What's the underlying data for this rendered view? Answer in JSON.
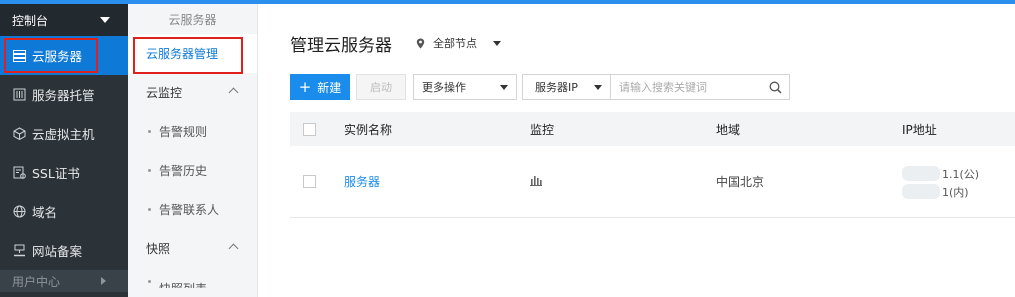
{
  "sidebar": {
    "header": "控制台",
    "items": [
      {
        "label": "云服务器",
        "icon": "server-list-icon",
        "active": true
      },
      {
        "label": "服务器托管",
        "icon": "server-rack-icon"
      },
      {
        "label": "云虚拟主机",
        "icon": "cube-icon"
      },
      {
        "label": "SSL证书",
        "icon": "certificate-icon"
      },
      {
        "label": "域名",
        "icon": "globe-icon"
      },
      {
        "label": "网站备案",
        "icon": "filing-icon"
      }
    ],
    "footer": "用户中心"
  },
  "subnav": {
    "title": "云服务器",
    "items": [
      {
        "label": "云服务器管理",
        "active": true
      },
      {
        "label": "云监控",
        "group": true
      },
      {
        "label": "告警规则"
      },
      {
        "label": "告警历史"
      },
      {
        "label": "告警联系人"
      },
      {
        "label": "快照",
        "group": true
      },
      {
        "label": "快照列表"
      }
    ]
  },
  "main": {
    "title": "管理云服务器",
    "region": "全部节点",
    "toolbar": {
      "new_label": "新建",
      "start_label": "启动",
      "more_label": "更多操作",
      "search_field": "服务器IP",
      "search_placeholder": "请输入搜索关键词"
    },
    "table": {
      "columns": [
        "实例名称",
        "监控",
        "地域",
        "IP地址"
      ],
      "rows": [
        {
          "name": "服务器",
          "region": "中国北京",
          "ip_public": "1.1(公)",
          "ip_private": "1(内)"
        }
      ]
    }
  },
  "colors": {
    "accent": "#1a8ceb",
    "sidebar_bg": "#2b3238",
    "highlight": "#e0201d"
  }
}
